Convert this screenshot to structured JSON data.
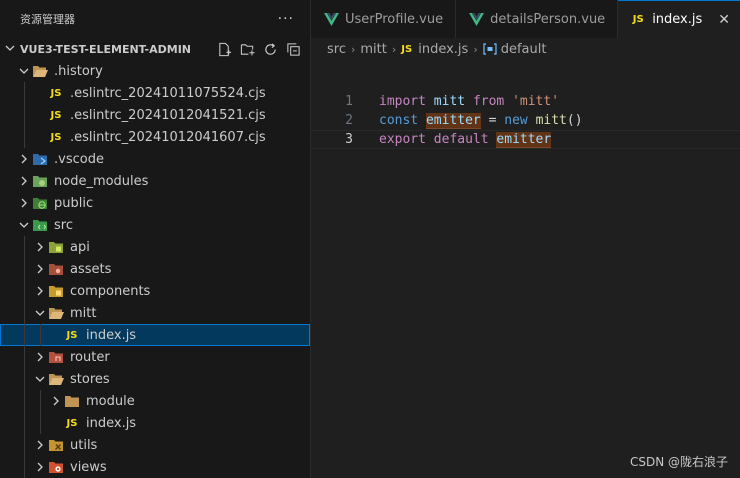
{
  "explorer": {
    "title": "资源管理器",
    "more": "···",
    "project": "VUE3-TEST-ELEMENT-ADMIN"
  },
  "tree": [
    {
      "label": ".history",
      "depth": 1,
      "kind": "folder",
      "expanded": true,
      "icon": "folder-open-icon"
    },
    {
      "label": ".eslintrc_20241011075524.cjs",
      "depth": 2,
      "kind": "js"
    },
    {
      "label": ".eslintrc_20241012041521.cjs",
      "depth": 2,
      "kind": "js"
    },
    {
      "label": ".eslintrc_20241012041607.cjs",
      "depth": 2,
      "kind": "js"
    },
    {
      "label": ".vscode",
      "depth": 1,
      "kind": "folder",
      "expanded": false,
      "icon": "vscode-folder-icon"
    },
    {
      "label": "node_modules",
      "depth": 1,
      "kind": "folder",
      "expanded": false,
      "icon": "node-folder-icon"
    },
    {
      "label": "public",
      "depth": 1,
      "kind": "folder",
      "expanded": false,
      "icon": "globe-folder-icon"
    },
    {
      "label": "src",
      "depth": 1,
      "kind": "folder",
      "expanded": true,
      "icon": "src-folder-icon"
    },
    {
      "label": "api",
      "depth": 2,
      "kind": "folder",
      "expanded": false,
      "icon": "api-folder-icon"
    },
    {
      "label": "assets",
      "depth": 2,
      "kind": "folder",
      "expanded": false,
      "icon": "assets-folder-icon"
    },
    {
      "label": "components",
      "depth": 2,
      "kind": "folder",
      "expanded": false,
      "icon": "components-folder-icon"
    },
    {
      "label": "mitt",
      "depth": 2,
      "kind": "folder",
      "expanded": true,
      "icon": "folder-open-icon"
    },
    {
      "label": "index.js",
      "depth": 3,
      "kind": "js",
      "selected": true
    },
    {
      "label": "router",
      "depth": 2,
      "kind": "folder",
      "expanded": false,
      "icon": "router-folder-icon"
    },
    {
      "label": "stores",
      "depth": 2,
      "kind": "folder",
      "expanded": true,
      "icon": "folder-open-icon"
    },
    {
      "label": "module",
      "depth": 3,
      "kind": "folder",
      "expanded": false,
      "icon": "folder-icon"
    },
    {
      "label": "index.js",
      "depth": 3,
      "kind": "js"
    },
    {
      "label": "utils",
      "depth": 2,
      "kind": "folder",
      "expanded": false,
      "icon": "utils-folder-icon"
    },
    {
      "label": "views",
      "depth": 2,
      "kind": "folder",
      "expanded": false,
      "icon": "views-folder-icon"
    }
  ],
  "tabs": [
    {
      "label": "UserProfile.vue",
      "kind": "vue",
      "active": false
    },
    {
      "label": "detailsPerson.vue",
      "kind": "vue",
      "active": false
    },
    {
      "label": "index.js",
      "kind": "js",
      "active": true,
      "close": "✕"
    }
  ],
  "breadcrumbs": {
    "parts": [
      "src",
      "mitt"
    ],
    "file": "index.js",
    "symbol": "default",
    "sep": "›"
  },
  "code": [
    {
      "n": "1",
      "tokens": [
        [
          "kw",
          "import"
        ],
        [
          "plain",
          " "
        ],
        [
          "var",
          "mitt"
        ],
        [
          "plain",
          " "
        ],
        [
          "kw",
          "from"
        ],
        [
          "plain",
          " "
        ],
        [
          "str",
          "'mitt'"
        ]
      ]
    },
    {
      "n": "2",
      "tokens": [
        [
          "kw2",
          "const"
        ],
        [
          "plain",
          " "
        ],
        [
          "var hl",
          "emitter"
        ],
        [
          "plain",
          " = "
        ],
        [
          "kw2",
          "new"
        ],
        [
          "plain",
          " "
        ],
        [
          "fn",
          "mitt"
        ],
        [
          "plain",
          "()"
        ]
      ]
    },
    {
      "n": "3",
      "current": true,
      "tokens": [
        [
          "kw",
          "export"
        ],
        [
          "plain",
          " "
        ],
        [
          "kw",
          "default"
        ],
        [
          "plain",
          " "
        ],
        [
          "var hl",
          "emitter"
        ]
      ]
    }
  ],
  "js_label": "JS",
  "watermark": "CSDN @陇右浪子",
  "colors": {
    "accent": "#0078d4",
    "selection": "#04395e",
    "js": "#f5de19",
    "vue": "#41b883"
  }
}
